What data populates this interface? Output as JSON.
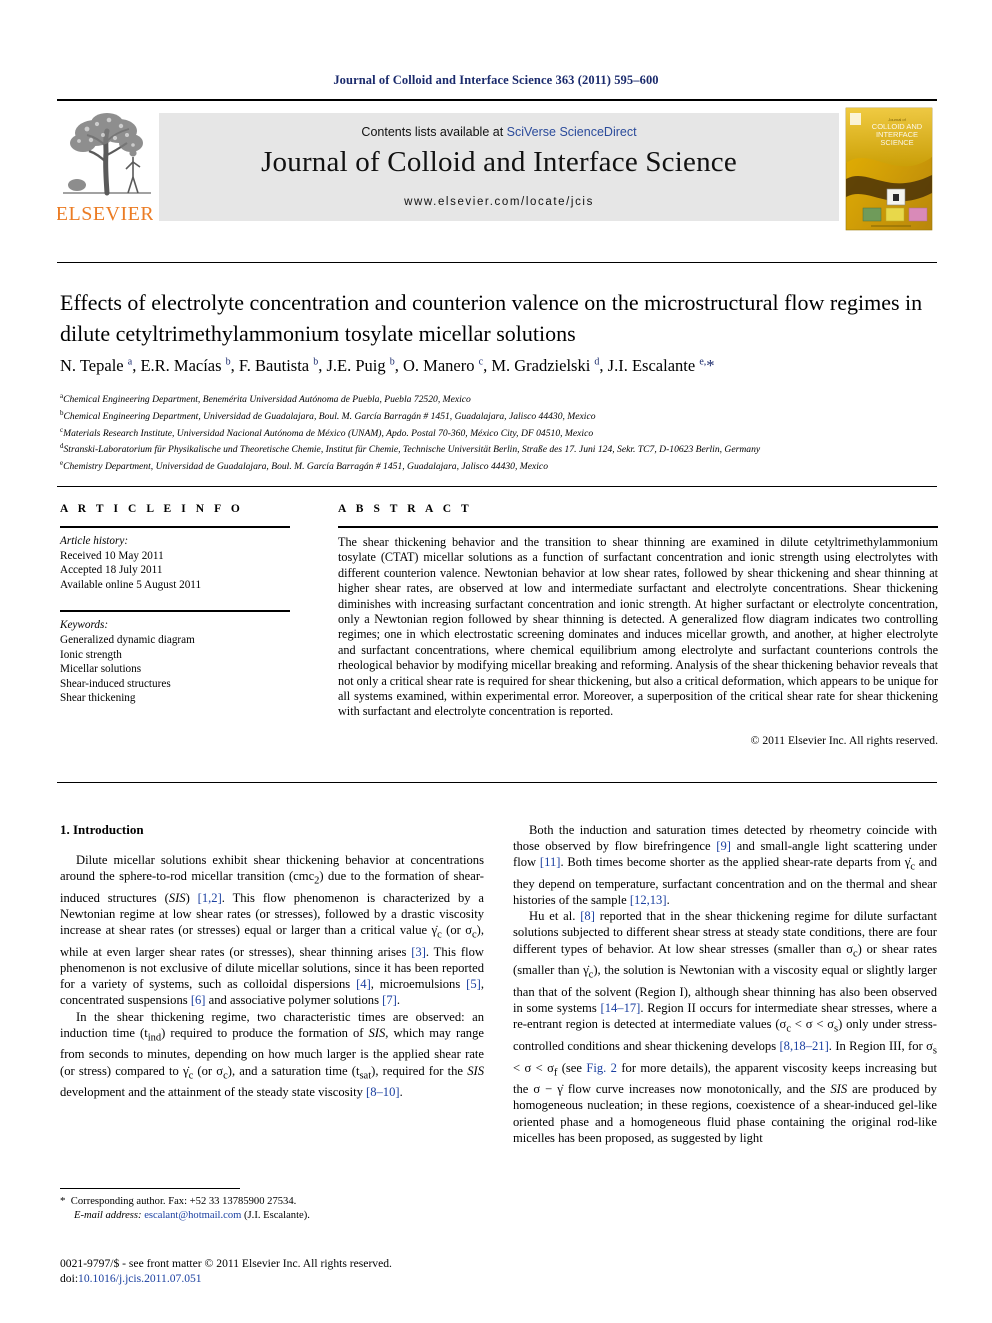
{
  "running_head": "Journal of Colloid and Interface Science 363 (2011) 595–600",
  "masthead": {
    "contents_prefix": "Contents lists available at ",
    "contents_link": "SciVerse ScienceDirect",
    "journal_title": "Journal of Colloid and Interface Science",
    "journal_url": "www.elsevier.com/locate/jcis",
    "publisher_name": "ELSEVIER",
    "cover_title_line1": "COLLOID AND",
    "cover_title_line2": "INTERFACE",
    "cover_title_line3": "SCIENCE",
    "cover_kicker": "Journal of"
  },
  "article": {
    "title": "Effects of electrolyte concentration and counterion valence on the microstructural flow regimes in dilute cetyltrimethylammonium tosylate micellar solutions",
    "authors_html": "N. Tepale <sup>a</sup>, E.R. Macías <sup>b</sup>, F. Bautista <sup>b</sup>, J.E. Puig <sup>b</sup>, O. Manero <sup>c</sup>, M. Gradzielski <sup>d</sup>, J.I. Escalante <sup>e,</sup><span class=\"star\">*</span>",
    "affiliations": [
      {
        "mark": "a",
        "text": "Chemical Engineering Department, Benemérita Universidad Autónoma de Puebla, Puebla 72520, Mexico"
      },
      {
        "mark": "b",
        "text": "Chemical Engineering Department, Universidad de Guadalajara, Boul. M. García Barragán # 1451, Guadalajara, Jalisco 44430, Mexico"
      },
      {
        "mark": "c",
        "text": "Materials Research Institute, Universidad Nacional Autónoma de México (UNAM), Apdo. Postal 70-360, México City, DF 04510, Mexico"
      },
      {
        "mark": "d",
        "text": "Stranski-Laboratorium für Physikalische und Theoretische Chemie, Institut für Chemie, Technische Universität Berlin, Straße des 17. Juni 124, Sekr. TC7, D-10623 Berlin, Germany"
      },
      {
        "mark": "e",
        "text": "Chemistry Department, Universidad de Guadalajara, Boul. M. García Barragán # 1451, Guadalajara, Jalisco 44430, Mexico"
      }
    ]
  },
  "article_info": {
    "heading": "A R T I C L E    I N F O",
    "history_label": "Article history:",
    "history": [
      "Received 10 May 2011",
      "Accepted 18 July 2011",
      "Available online 5 August 2011"
    ],
    "keywords_label": "Keywords:",
    "keywords": [
      "Generalized dynamic diagram",
      "Ionic strength",
      "Micellar solutions",
      "Shear-induced structures",
      "Shear thickening"
    ]
  },
  "abstract": {
    "heading": "A B S T R A C T",
    "text": "The shear thickening behavior and the transition to shear thinning are examined in dilute cetyltrimethylammonium tosylate (CTAT) micellar solutions as a function of surfactant concentration and ionic strength using electrolytes with different counterion valence. Newtonian behavior at low shear rates, followed by shear thickening and shear thinning at higher shear rates, are observed at low and intermediate surfactant and electrolyte concentrations. Shear thickening diminishes with increasing surfactant concentration and ionic strength. At higher surfactant or electrolyte concentration, only a Newtonian region followed by shear thinning is detected. A generalized flow diagram indicates two controlling regimes; one in which electrostatic screening dominates and induces micellar growth, and another, at higher electrolyte and surfactant concentrations, where chemical equilibrium among electrolyte and surfactant counterions controls the rheological behavior by modifying micellar breaking and reforming. Analysis of the shear thickening behavior reveals that not only a critical shear rate is required for shear thickening, but also a critical deformation, which appears to be unique for all systems examined, within experimental error. Moreover, a superposition of the critical shear rate for shear thickening with surfactant and electrolyte concentration is reported.",
    "copyright": "© 2011 Elsevier Inc. All rights reserved."
  },
  "body": {
    "section_heading": "1. Introduction",
    "left_paragraphs_html": [
      "Dilute micellar solutions exhibit shear thickening behavior at concentrations around the sphere-to-rod micellar transition (cmc<sub>2</sub>) due to the formation of shear-induced structures (<span class=\"it\">SIS</span>) <span class=\"ref\">[1,2]</span>. This flow phenomenon is characterized by a Newtonian regime at low shear rates (or stresses), followed by a drastic viscosity increase at shear rates (or stresses) equal or larger than a critical value &gamma;&#775;<sub>c</sub> (or &sigma;<sub>c</sub>), while at even larger shear rates (or stresses), shear thinning arises <span class=\"ref\">[3]</span>. This flow phenomenon is not exclusive of dilute micellar solutions, since it has been reported for a variety of systems, such as colloidal dispersions <span class=\"ref\">[4]</span>, microemulsions <span class=\"ref\">[5]</span>, concentrated suspensions <span class=\"ref\">[6]</span> and associative polymer solutions <span class=\"ref\">[7]</span>.",
      "In the shear thickening regime, two characteristic times are observed: an induction time (t<sub>ind</sub>) required to produce the formation of <span class=\"it\">SIS</span>, which may range from seconds to minutes, depending on how much larger is the applied shear rate (or stress) compared to &gamma;&#775;<sub>c</sub> (or &sigma;<sub>c</sub>), and a saturation time (t<sub>sat</sub>), required for the <span class=\"it\">SIS</span> development and the attainment of the steady state viscosity <span class=\"ref\">[8–10]</span>."
    ],
    "right_paragraphs_html": [
      "Both the induction and saturation times detected by rheometry coincide with those observed by flow birefringence <span class=\"ref\">[9]</span> and small-angle light scattering under flow <span class=\"ref\">[11]</span>. Both times become shorter as the applied shear-rate departs from &gamma;&#775;<sub>c</sub> and they depend on temperature, surfactant concentration and on the thermal and shear histories of the sample <span class=\"ref\">[12,13]</span>.",
      "Hu et al. <span class=\"ref\">[8]</span> reported that in the shear thickening regime for dilute surfactant solutions subjected to different shear stress at steady state conditions, there are four different types of behavior. At low shear stresses (smaller than &sigma;<sub>c</sub>) or shear rates (smaller than &gamma;&#775;<sub>c</sub>), the solution is Newtonian with a viscosity equal or slightly larger than that of the solvent (Region I), although shear thinning has also been observed in some systems <span class=\"ref\">[14–17]</span>. Region II occurs for intermediate shear stresses, where a re-entrant region is detected at intermediate values (&sigma;<sub>c</sub> &lt; &sigma; &lt; &sigma;<sub>s</sub>) only under stress-controlled conditions and shear thickening develops <span class=\"ref\">[8,18–21]</span>. In Region III, for &sigma;<sub>s</sub> &lt; &sigma; &lt; &sigma;<sub>f</sub> (see <span class=\"ref\">Fig. 2</span> for more details), the apparent viscosity keeps increasing but the &sigma; &minus; &gamma;&#775; flow curve increases now monotonically, and the <span class=\"it\">SIS</span> are produced by homogeneous nucleation; in these regions, coexistence of a shear-induced gel-like oriented phase and a homogeneous fluid phase containing the original rod-like micelles has been proposed, as suggested by light"
    ]
  },
  "footnote": {
    "corresponding_html": "<span class=\"star\">*</span>&nbsp; Corresponding author. Fax: +52 33 13785900 27534.",
    "email_label": "E-mail address:",
    "email": "escalant@hotmail.com",
    "email_person": "(J.I. Escalante)."
  },
  "footer": {
    "issn_line": "0021-9797/$ - see front matter © 2011 Elsevier Inc. All rights reserved.",
    "doi_label": "doi:",
    "doi_value": "10.1016/j.jcis.2011.07.051"
  },
  "colors": {
    "link_blue": "#2b4b9b",
    "ref_blue": "#1a3fa0",
    "runhead_blue": "#1a2a6c",
    "elsevier_orange": "#eb7c24",
    "band_gray": "#e6e6e6"
  }
}
